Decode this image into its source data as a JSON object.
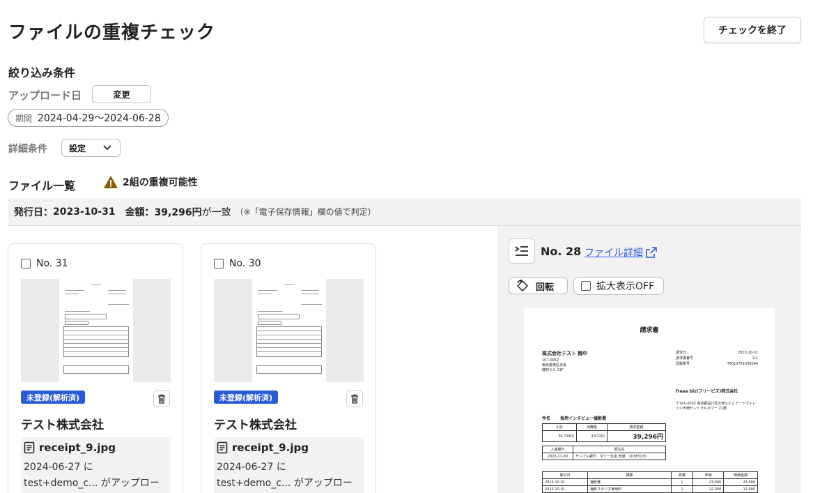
{
  "header": {
    "title": "ファイルの重複チェック",
    "end_button": "チェックを終了"
  },
  "filter": {
    "heading": "絞り込み条件",
    "upload_label": "アップロード日",
    "change_button": "変更",
    "period_key": "期間",
    "period_value": "2024-04-29〜2024-06-28",
    "detail_label": "詳細条件",
    "setting_button": "設定"
  },
  "file_list": {
    "heading": "ファイル一覧",
    "warning": "2組の重複可能性",
    "match": {
      "date_label": "発行日：",
      "date_value": "2023-10-31",
      "amount_label": "金額：",
      "amount_value": "39,296円",
      "suffix": "が一致",
      "note": "（※「電子保存情報」欄の値で判定）"
    }
  },
  "cards": [
    {
      "no": "No. 31",
      "status": "未登録(解析済)",
      "company": "テスト株式会社",
      "file_name": "receipt_9.jpg",
      "upload_date": "2024-06-27 に",
      "uploader": "test+demo_c... がアップロード"
    },
    {
      "no": "No. 30",
      "status": "未登録(解析済)",
      "company": "テスト株式会社",
      "file_name": "receipt_9.jpg",
      "upload_date": "2024-06-27 に",
      "uploader": "test+demo_c... がアップロード"
    }
  ],
  "preview": {
    "no": "No. 28",
    "detail_link": "ファイル詳細",
    "rotate_button": "回転",
    "zoom_toggle": "拡大表示OFF",
    "invoice": {
      "title": "請求書",
      "to": "株式会社テスト 御中",
      "addr1": "107-0052",
      "addr2": "東京都港区赤坂",
      "addr3": "機材ビル 21F",
      "meta": [
        {
          "k": "請求日",
          "v": "2023-10-31"
        },
        {
          "k": "請求書番号",
          "v": "2-1"
        },
        {
          "k": "登録番号",
          "v": "T6010701039064"
        }
      ],
      "issuer": "freee biz(フリービズ)株式会社",
      "issuer_addr": "〒141-0032 東京都品川区大崎1-2-2 アートヴィレッジ大崎セントラルタワー 21階",
      "subject_label": "件名",
      "subject": "採用インタビュー撮影費",
      "sum_headers": [
        "小計",
        "消費税",
        "請求金額"
      ],
      "sum_values": [
        "35,724円",
        "3,572円",
        "39,296円"
      ],
      "pay_headers": [
        "入金期日",
        "振込先"
      ],
      "pay_values": [
        "2023-11-30",
        "サンプル銀行　ダミー支店 普通　10385170"
      ],
      "item_headers": [
        "取引日",
        "摘要",
        "数量",
        "単価",
        "明細金額"
      ],
      "items": [
        [
          "2023-10-01",
          "撮影費",
          "1",
          "23,000",
          "23,000"
        ],
        [
          "2023-10-01",
          "撮影スタジオ使用料",
          "1",
          "12,000",
          "12,000"
        ]
      ]
    }
  }
}
